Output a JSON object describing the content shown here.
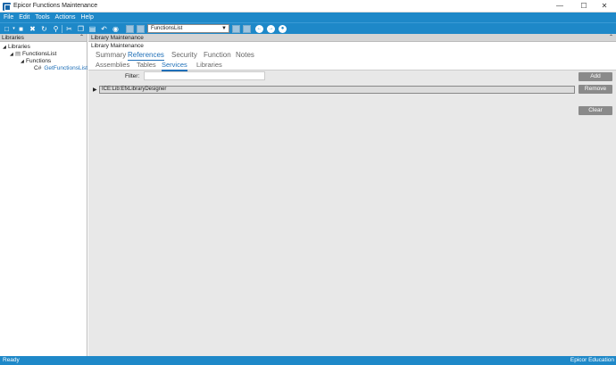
{
  "window": {
    "title": "Epicor Functions Maintenance"
  },
  "menu": [
    "File",
    "Edit",
    "Tools",
    "Actions",
    "Help"
  ],
  "toolbar": {
    "selected_function": "FunctionsList"
  },
  "left_panel": {
    "header": "Libraries",
    "tree": [
      {
        "label": "Libraries",
        "level": 0
      },
      {
        "label": "FunctionsList",
        "level": 1
      },
      {
        "label": "Functions",
        "level": 2
      },
      {
        "label": "GetFunctionsList",
        "level": 3,
        "prefix": "C#"
      }
    ]
  },
  "main": {
    "header": "Library Maintenance",
    "tabs": [
      "Summary",
      "References",
      "Security",
      "Function",
      "Notes"
    ],
    "active_tab": "References",
    "subtabs": [
      "Assemblies",
      "Tables",
      "Services",
      "Libraries"
    ],
    "active_subtab": "Services",
    "filter_label": "Filter:",
    "filter_value": "",
    "rows": [
      "ICE:Lib:EfxLibraryDesigner"
    ],
    "buttons": {
      "add": "Add",
      "remove": "Remove",
      "clear": "Clear"
    }
  },
  "status": {
    "left": "Ready",
    "right": "Epicor Education"
  },
  "colors": {
    "accent": "#1e88c8",
    "link": "#1e6fb8"
  }
}
